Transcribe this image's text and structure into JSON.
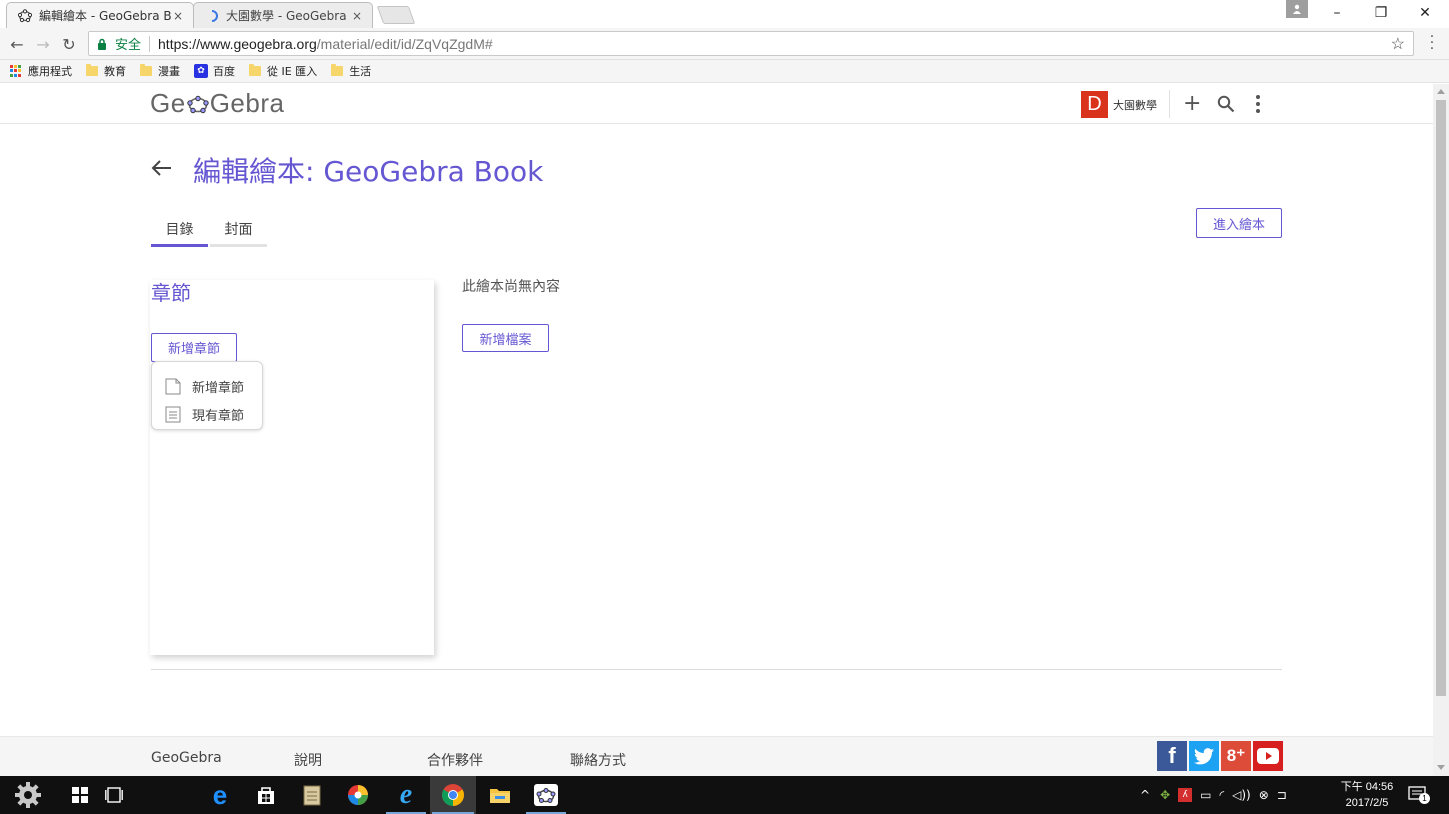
{
  "browser": {
    "tabs": [
      {
        "title": "編輯繪本 - GeoGebra Bo",
        "close": "×",
        "active": true
      },
      {
        "title": "大園數學 - GeoGebra",
        "close": "×",
        "active": false
      }
    ],
    "window_controls": {
      "minimize": "–",
      "restore": "❐",
      "close": "✕"
    },
    "nav": {
      "back": "←",
      "forward": "→",
      "reload": "↻"
    },
    "address": {
      "secure_label": "安全",
      "url_host": "https://www.geogebra.org",
      "url_path": "/material/edit/id/ZqVqZgdM#",
      "star": "☆"
    },
    "bookmarks": [
      {
        "label": "應用程式",
        "kind": "apps"
      },
      {
        "label": "教育",
        "kind": "folder"
      },
      {
        "label": "漫畫",
        "kind": "folder"
      },
      {
        "label": "百度",
        "kind": "baidu"
      },
      {
        "label": "從 IE 匯入",
        "kind": "folder"
      },
      {
        "label": "生活",
        "kind": "folder"
      }
    ]
  },
  "header": {
    "logo_left": "Ge",
    "logo_right": "Gebra",
    "user_initial": "D",
    "user_name": "大園數學",
    "add": "+"
  },
  "page": {
    "back_arrow": "←",
    "title": "編輯繪本: GeoGebra Book",
    "tabs": [
      {
        "label": "目錄",
        "selected": true
      },
      {
        "label": "封面",
        "selected": false
      }
    ],
    "enter_book_label": "進入繪本",
    "chapters": {
      "heading": "章節",
      "add_button": "新增章節",
      "menu": [
        {
          "label": "新增章節",
          "icon": "blank-page-icon"
        },
        {
          "label": "現有章節",
          "icon": "text-page-icon"
        }
      ]
    },
    "empty_message": "此繪本尚無內容",
    "add_file_label": "新增檔案"
  },
  "footer": {
    "links": [
      "GeoGebra",
      "說明",
      "合作夥伴",
      "聯絡方式"
    ],
    "social": [
      {
        "name": "facebook",
        "glyph": "f",
        "color": "#3b5998"
      },
      {
        "name": "twitter",
        "glyph": "t",
        "color": "#1da1f2"
      },
      {
        "name": "google-plus",
        "glyph": "8⁺",
        "color": "#dd4b39"
      },
      {
        "name": "youtube",
        "glyph": "▶",
        "color": "#d81f1f"
      }
    ]
  },
  "taskbar": {
    "clock_time": "下午 04:56",
    "clock_date": "2017/2/5",
    "notification_count": "1"
  },
  "colors": {
    "accent": "#6557d2",
    "avatar": "#d9341b",
    "secure": "#0b8043"
  }
}
